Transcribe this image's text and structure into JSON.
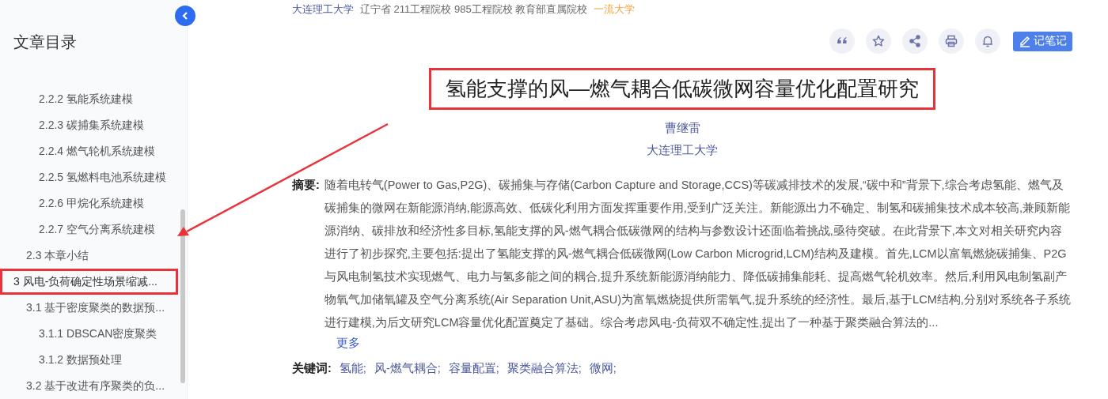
{
  "sidebar": {
    "title": "文章目录",
    "toc": [
      {
        "children": [
          {
            "children": [
              {
                "label": "2.2.2 氢能系统建模",
                "selected": false
              },
              {
                "label": "2.2.3 碳捕集系统建模",
                "selected": false
              },
              {
                "label": "2.2.4 燃气轮机系统建模",
                "selected": false
              },
              {
                "label": "2.2.5 氢燃料电池系统建模",
                "selected": false
              },
              {
                "label": "2.2.6 甲烷化系统建模",
                "selected": false
              },
              {
                "label": "2.2.7 空气分离系统建模",
                "selected": false
              }
            ]
          },
          {
            "label": "2.3 本章小结",
            "selected": false
          }
        ]
      },
      {
        "label": "3 风电-负荷确定性场景缩减...",
        "selected": true,
        "children": [
          {
            "label": "3.1 基于密度聚类的数据预...",
            "selected": false,
            "children": [
              {
                "label": "3.1.1 DBSCAN密度聚类",
                "selected": false
              },
              {
                "label": "3.1.2 数据预处理",
                "selected": false
              }
            ]
          },
          {
            "label": "3.2 基于改进有序聚类的负...",
            "selected": false
          }
        ]
      }
    ]
  },
  "header": {
    "university": "大连理工大学",
    "tags": "辽宁省 211工程院校 985工程院校 教育部直属院校",
    "rank": "一流大学"
  },
  "toolbar": {
    "icons": [
      {
        "kind": "quote"
      },
      {
        "kind": "star"
      },
      {
        "kind": "share"
      },
      {
        "kind": "print"
      },
      {
        "kind": "bell"
      }
    ],
    "note_button": "记笔记"
  },
  "paper": {
    "title": "氢能支撑的风—燃气耦合低碳微网容量优化配置研究",
    "author": "曹继雷",
    "affiliation": "大连理工大学",
    "abstract_label": "摘要:",
    "abstract": "随着电转气(Power to Gas,P2G)、碳捕集与存储(Carbon Capture and Storage,CCS)等碳减排技术的发展,“碳中和”背景下,综合考虑氢能、燃气及碳捕集的微网在新能源消纳,能源高效、低碳化利用方面发挥重要作用,受到广泛关注。新能源出力不确定、制氢和碳捕集技术成本较高,兼顾新能源消纳、碳排放和经济性多目标,氢能支撑的风-燃气耦合低碳微网的结构与参数设计还面临着挑战,亟待突破。在此背景下,本文对相关研究内容进行了初步探究,主要包括:提出了氢能支撑的风-燃气耦合低碳微网(Low Carbon Microgrid,LCM)结构及建模。首先,LCM以富氧燃烧碳捕集、P2G与风电制氢技术实现燃气、电力与氢多能之间的耦合,提升系统新能源消纳能力、降低碳捕集能耗、提高燃气轮机效率。然后,利用风电制氢副产物氧气加储氧罐及空气分离系统(Air Separation Unit,ASU)为富氧燃烧提供所需氧气,提升系统的经济性。最后,基于LCM结构,分别对系统各子系统进行建模,为后文研究LCM容量优化配置奠定了基础。综合考虑风电-负荷双不确定性,提出了一种基于聚类融合算法的...",
    "more": "更多",
    "keywords_label": "关键词:",
    "keywords": [
      "氢能;",
      "风-燃气耦合;",
      "容量配置;",
      "聚类融合算法;",
      "微网;"
    ]
  }
}
